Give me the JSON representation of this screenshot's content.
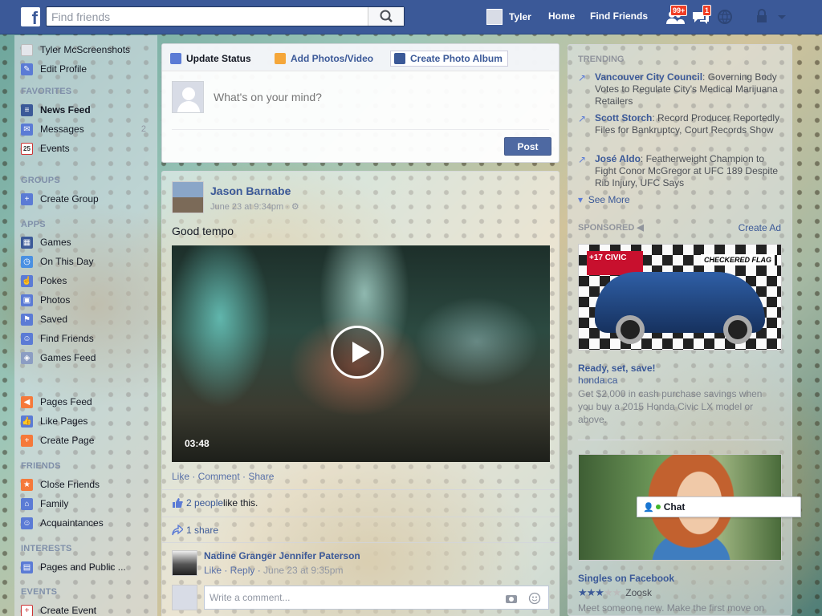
{
  "topbar": {
    "search_placeholder": "Find friends",
    "user_name": "Tyler",
    "home": "Home",
    "find_friends": "Find Friends",
    "friend_requests_badge": "99+",
    "messages_badge": "1",
    "brand_color": "#3b5998"
  },
  "left_nav": {
    "profile_name": "Tyler McScreenshots",
    "edit_profile": "Edit Profile",
    "favorites_head": "FAVORITES",
    "news_feed": "News Feed",
    "messages": "Messages",
    "messages_count": "2",
    "events": "Events",
    "events_icon_text": "25",
    "groups_head": "GROUPS",
    "create_group": "Create Group",
    "apps_head": "APPS",
    "games": "Games",
    "on_this_day": "On This Day",
    "pokes": "Pokes",
    "photos": "Photos",
    "saved": "Saved",
    "find_friends": "Find Friends",
    "games_feed": "Games Feed",
    "pages_feed": "Pages Feed",
    "like_pages": "Like Pages",
    "create_page": "Create Page",
    "friends_head": "FRIENDS",
    "close_friends": "Close Friends",
    "family": "Family",
    "acquaintances": "Acquaintances",
    "interests_head": "INTERESTS",
    "pages_and_public": "Pages and Public ...",
    "events_head": "EVENTS",
    "create_event": "Create Event"
  },
  "composer": {
    "tab_update_status": "Update Status",
    "tab_add_photos": "Add Photos/Video",
    "tab_create_album": "Create Photo Album",
    "placeholder": "What's on your mind?",
    "post_label": "Post"
  },
  "story": {
    "author": "Jason Barnabe",
    "time": "June 23 at 9:34pm · ⚙",
    "text": "Good tempo",
    "video_duration": "03:48",
    "actions": "Like · Comment · Share",
    "likes_count": "2 people",
    "likes_suffix": " like this.",
    "shares": "1 share",
    "comment_author": "Nadine Granger",
    "comment_text": "Jennifer Paterson",
    "comment_actions": "Like · Reply · ",
    "comment_time": "June 23 at 9:35pm",
    "comment_placeholder": "Write a comment..."
  },
  "right_col": {
    "trending_head": "TRENDING",
    "trends": [
      {
        "name": "Vancouver City Council",
        "desc": ": Governing Body Votes to Regulate City's Medical Marijuana Retailers"
      },
      {
        "name": "Scott Storch",
        "desc": ": Record Producer Reportedly Files for Bankruptcy, Court Records Show"
      },
      {
        "name": "José Aldo",
        "desc": ": Featherweight Champion to Fight Conor McGregor at UFC 189 Despite Rib Injury, UFC Says"
      }
    ],
    "see_more": "See More",
    "sponsored_head": "SPONSORED",
    "create_ad": "Create Ad",
    "ad1": {
      "logo_text": "+17 CIVIC",
      "badge_text": "CHECKERED FLAG",
      "title": "Ready, set, save!",
      "domain": "honda.ca",
      "body": "Get $2,000 in cash purchase savings when you buy a 2015 Honda Civic LX model or above."
    },
    "ad2": {
      "title": "Singles on Facebook",
      "source": "Zoosk",
      "rating": 3,
      "rating_max": 5,
      "body": "Meet someone new. Make the first move on"
    }
  },
  "chat": {
    "label": "Chat"
  }
}
